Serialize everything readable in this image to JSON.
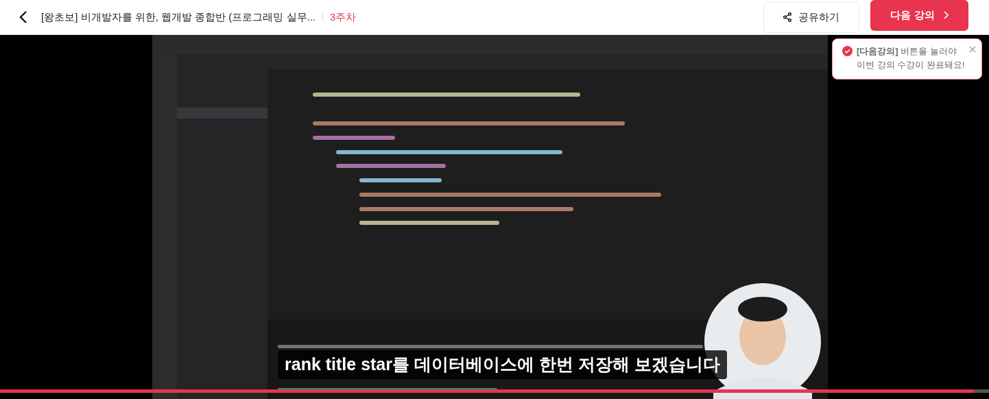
{
  "header": {
    "title": "[왕초보] 비개발자를 위한, 웹개발 종합반 (프로그래밍 실무...",
    "week": "3주차",
    "share_button": "공유하기",
    "next_button": "다음 강의"
  },
  "tooltip": {
    "text": "**[다음강의]** 버튼을 눌러야 이번 강의 수강이 완료돼요!"
  },
  "video": {
    "kind": "picture",
    "subtitle": "rank title star를 데이터베이스에 한번 저장해 보겠습니다",
    "progress": {
      "level": 0.985
    }
  }
}
